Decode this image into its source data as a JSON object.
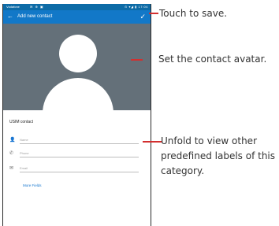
{
  "status_bar": {
    "carrier": "Vodafone",
    "left_icons": "✉ ⊕ ▣",
    "right_text": "⊙ ▾◢ ▮ 17:04"
  },
  "app_bar": {
    "back_glyph": "←",
    "title": "Add new contact",
    "save_glyph": "✓"
  },
  "avatar": {
    "background_color": "#647079"
  },
  "form": {
    "section_header": "USIM contact",
    "fields": [
      {
        "icon": "person-icon",
        "glyph": "👤",
        "placeholder": "Name"
      },
      {
        "icon": "phone-icon",
        "glyph": "✆",
        "placeholder": "Phone"
      },
      {
        "icon": "email-icon",
        "glyph": "✉",
        "placeholder": "Email"
      }
    ],
    "more_fields": "More Fields"
  },
  "callouts": {
    "save": "Touch to save.",
    "avatar": "Set the contact avatar.",
    "more_fields": "Unfold to view other predefined labels of this category."
  },
  "colors": {
    "app_bar": "#1278c8",
    "status_bar": "#0d6ba6",
    "link": "#1a7ad0",
    "callout_line": "#d32f2f"
  }
}
